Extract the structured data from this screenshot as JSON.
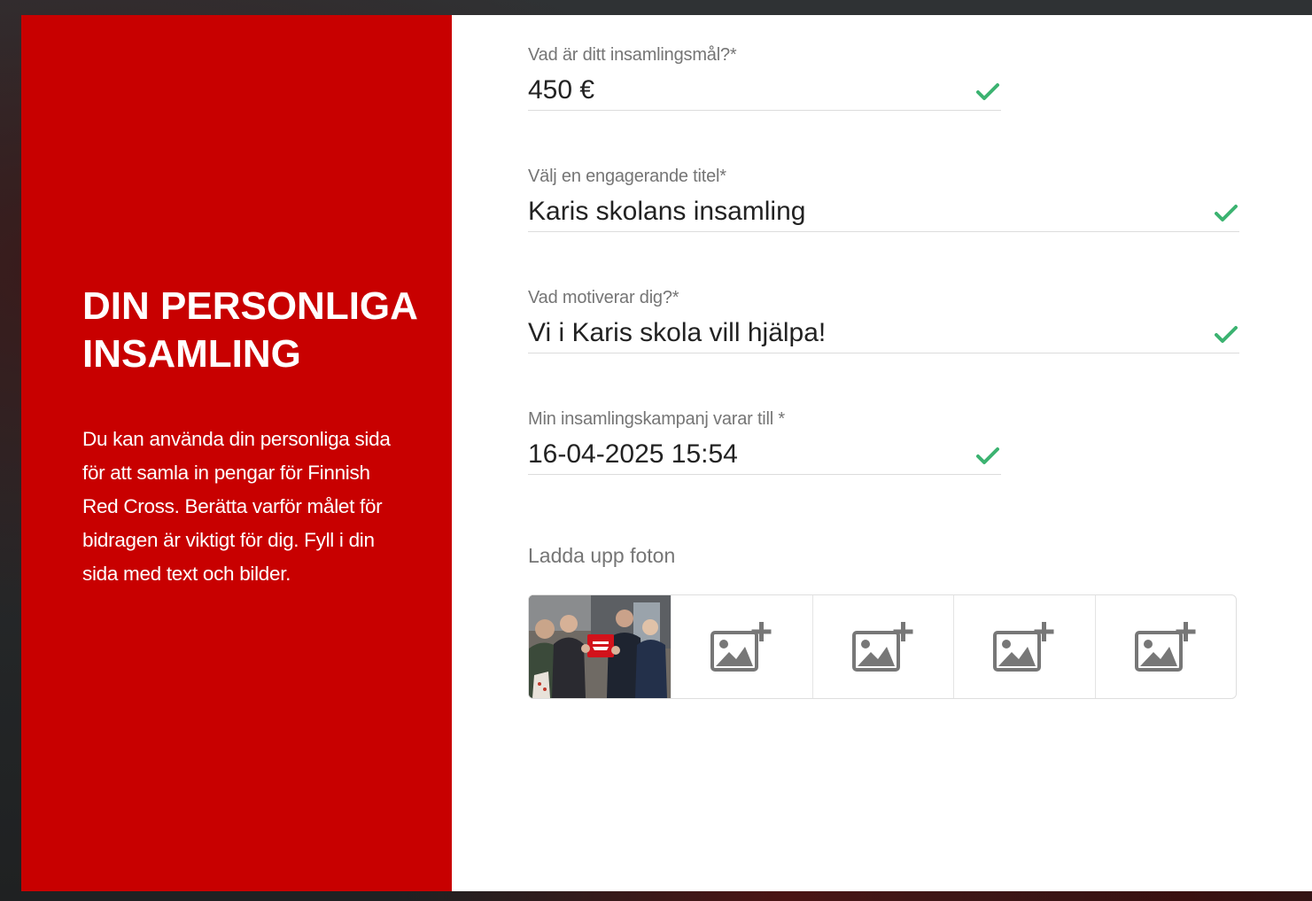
{
  "panel": {
    "heading": "DIN PERSONLIGA INSAMLING",
    "description": "Du kan använda din personliga sida för att samla in pengar för Finnish Red Cross. Berätta varför målet för bidragen är viktigt för dig. Fyll i din sida med text och bilder."
  },
  "form": {
    "goal": {
      "label": "Vad är ditt insamlingsmål?",
      "required": "*",
      "value": "450 €"
    },
    "title": {
      "label": "Välj en engagerande titel",
      "required": "*",
      "value": "Karis skolans insamling"
    },
    "motivation": {
      "label": "Vad motiverar dig?",
      "required": "*",
      "value": "Vi i Karis skola vill hjälpa!"
    },
    "end_date": {
      "label": "Min insamlingskampanj varar till",
      "required": " *",
      "value": "16-04-2025 15:54"
    }
  },
  "upload": {
    "label": "Ladda upp foton",
    "slots": [
      {
        "state": "uploaded",
        "icon": "photo-thumbnail"
      },
      {
        "state": "empty",
        "icon": "add-photo-icon"
      },
      {
        "state": "empty",
        "icon": "add-photo-icon"
      },
      {
        "state": "empty",
        "icon": "add-photo-icon"
      },
      {
        "state": "empty",
        "icon": "add-photo-icon"
      }
    ]
  },
  "colors": {
    "brand_red": "#c80000",
    "check_green": "#3cb371",
    "label_grey": "#757575",
    "icon_grey": "#777777"
  }
}
